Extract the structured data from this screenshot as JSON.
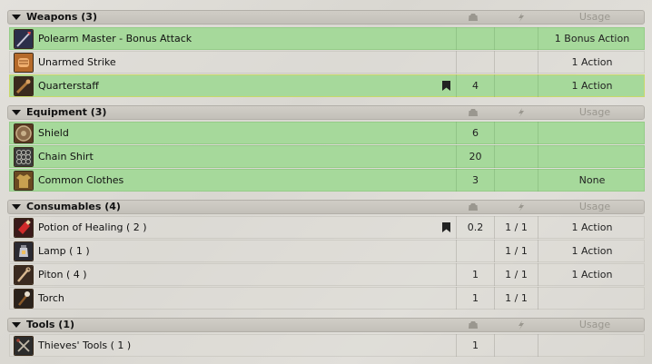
{
  "columns": {
    "usage_label": "Usage"
  },
  "sections": [
    {
      "title": "Weapons (3)",
      "items": [
        {
          "name": "Polearm Master - Bonus Attack",
          "weight": "",
          "charges": "",
          "usage": "1 Bonus Action",
          "equipped": true,
          "bookmark": false,
          "icon": "glaive-icon"
        },
        {
          "name": "Unarmed Strike",
          "weight": "",
          "charges": "",
          "usage": "1 Action",
          "equipped": false,
          "bookmark": false,
          "icon": "fist-icon"
        },
        {
          "name": "Quarterstaff",
          "weight": "4",
          "charges": "",
          "usage": "1 Action",
          "equipped": true,
          "bookmark": true,
          "icon": "staff-icon"
        }
      ]
    },
    {
      "title": "Equipment (3)",
      "items": [
        {
          "name": "Shield",
          "weight": "6",
          "charges": "",
          "usage": "",
          "equipped": true,
          "bookmark": false,
          "icon": "shield-icon"
        },
        {
          "name": "Chain Shirt",
          "weight": "20",
          "charges": "",
          "usage": "",
          "equipped": true,
          "bookmark": false,
          "icon": "chain-shirt-icon"
        },
        {
          "name": "Common Clothes",
          "weight": "3",
          "charges": "",
          "usage": "None",
          "equipped": true,
          "bookmark": false,
          "icon": "clothes-icon"
        }
      ]
    },
    {
      "title": "Consumables (4)",
      "items": [
        {
          "name": "Potion of Healing ( 2 )",
          "weight": "0.2",
          "charges": "1 / 1",
          "usage": "1 Action",
          "equipped": false,
          "bookmark": true,
          "icon": "potion-icon"
        },
        {
          "name": "Lamp ( 1 )",
          "weight": "",
          "charges": "1 / 1",
          "usage": "1 Action",
          "equipped": false,
          "bookmark": false,
          "icon": "lamp-icon"
        },
        {
          "name": "Piton ( 4 )",
          "weight": "1",
          "charges": "1 / 1",
          "usage": "1 Action",
          "equipped": false,
          "bookmark": false,
          "icon": "piton-icon"
        },
        {
          "name": "Torch",
          "weight": "1",
          "charges": "1 / 1",
          "usage": "",
          "equipped": false,
          "bookmark": false,
          "icon": "torch-icon"
        }
      ]
    },
    {
      "title": "Tools (1)",
      "items": [
        {
          "name": "Thieves' Tools ( 1 )",
          "weight": "1",
          "charges": "",
          "usage": "",
          "equipped": false,
          "bookmark": false,
          "icon": "lockpicks-icon"
        }
      ]
    }
  ],
  "colors": {
    "equipped_row": "#a6d99b",
    "header": "#c9c6bf",
    "selected_border": "#c8d86a"
  }
}
